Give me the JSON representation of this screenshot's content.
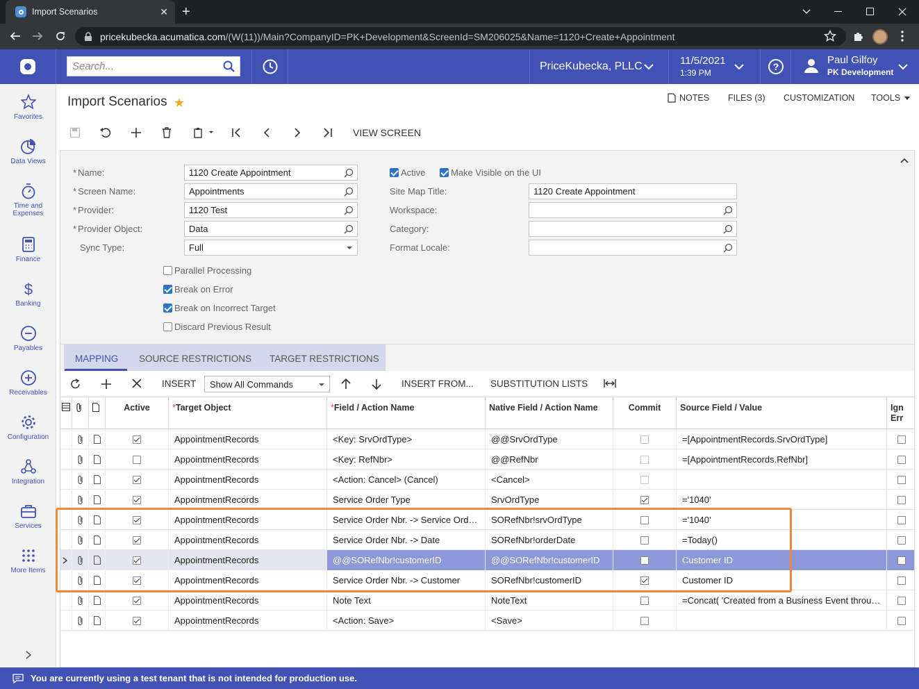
{
  "browser": {
    "tab_title": "Import Scenarios",
    "url_host": "pricekubecka.acumatica.com",
    "url_path": "/(W(11))/Main?CompanyID=PK+Development&ScreenId=SM206025&Name=1120+Create+Appointment"
  },
  "appbar": {
    "search_placeholder": "Search...",
    "company": "PriceKubecka, PLLC",
    "date": "11/5/2021",
    "time": "1:39 PM",
    "user_name": "Paul Gilfoy",
    "user_branch": "PK Development"
  },
  "sidebar": {
    "items": [
      {
        "label": "Favorites",
        "icon": "star-icon"
      },
      {
        "label": "Data Views",
        "icon": "pie-chart-icon"
      },
      {
        "label": "Time and Expenses",
        "icon": "stopwatch-icon"
      },
      {
        "label": "Finance",
        "icon": "calculator-icon"
      },
      {
        "label": "Banking",
        "icon": "dollar-icon"
      },
      {
        "label": "Payables",
        "icon": "minus-circle-icon"
      },
      {
        "label": "Receivables",
        "icon": "plus-circle-icon"
      },
      {
        "label": "Configuration",
        "icon": "gear-icon"
      },
      {
        "label": "Integration",
        "icon": "network-icon"
      },
      {
        "label": "Services",
        "icon": "briefcase-icon"
      },
      {
        "label": "More Items",
        "icon": "grid-dots-icon"
      }
    ]
  },
  "page": {
    "title": "Import Scenarios",
    "links": {
      "notes": "NOTES",
      "files": "FILES (3)",
      "customization": "CUSTOMIZATION",
      "tools": "TOOLS"
    },
    "view_screen": "VIEW SCREEN"
  },
  "form": {
    "name_label": "Name:",
    "name_value": "1120 Create Appointment",
    "screen_name_label": "Screen Name:",
    "screen_name_value": "Appointments",
    "provider_label": "Provider:",
    "provider_value": "1120 Test",
    "provider_object_label": "Provider Object:",
    "provider_object_value": "Data",
    "sync_type_label": "Sync Type:",
    "sync_type_value": "Full",
    "parallel_processing": "Parallel Processing",
    "break_on_error": "Break on Error",
    "break_on_incorrect_target": "Break on Incorrect Target",
    "discard_previous_result": "Discard Previous Result",
    "active": "Active",
    "make_visible": "Make Visible on the UI",
    "site_map_title_label": "Site Map Title:",
    "site_map_title_value": "1120 Create Appointment",
    "workspace_label": "Workspace:",
    "category_label": "Category:",
    "format_locale_label": "Format Locale:"
  },
  "tabs": {
    "mapping": "MAPPING",
    "source_restrictions": "SOURCE RESTRICTIONS",
    "target_restrictions": "TARGET RESTRICTIONS"
  },
  "grid_toolbar": {
    "insert": "INSERT",
    "show_commands": "Show All Commands",
    "insert_from": "INSERT FROM...",
    "substitution_lists": "SUBSTITUTION LISTS"
  },
  "grid": {
    "headers": {
      "active": "Active",
      "target_object": "Target Object",
      "field_action": "Field / Action Name",
      "native_field": "Native Field / Action Name",
      "commit": "Commit",
      "source_field": "Source Field / Value",
      "ignore1": "Ign",
      "ignore2": "Err"
    },
    "rows": [
      {
        "active": true,
        "target": "AppointmentRecords",
        "field": "<Key: SrvOrdType>",
        "native": "@@SrvOrdType",
        "commit": false,
        "commit_dim": true,
        "source": "=[AppointmentRecords.SrvOrdType]"
      },
      {
        "active": false,
        "target": "AppointmentRecords",
        "field": "<Key: RefNbr>",
        "native": "@@RefNbr",
        "commit": false,
        "commit_dim": true,
        "source": "=[AppointmentRecords.RefNbr]"
      },
      {
        "active": true,
        "target": "AppointmentRecords",
        "field": "<Action: Cancel> (Cancel)",
        "native": "<Cancel>",
        "commit": false,
        "commit_dim": true,
        "source": ""
      },
      {
        "active": true,
        "target": "AppointmentRecords",
        "field": "Service Order Type",
        "native": "SrvOrdType",
        "commit": true,
        "commit_dim": false,
        "source": "='1040'"
      },
      {
        "active": true,
        "target": "AppointmentRecords",
        "field": "Service Order Nbr. -> Service Ord…",
        "native": "SORefNbr!srvOrdType",
        "commit": false,
        "commit_dim": false,
        "source": "='1040'"
      },
      {
        "active": true,
        "target": "AppointmentRecords",
        "field": "Service Order Nbr. -> Date",
        "native": "SORefNbr!orderDate",
        "commit": false,
        "commit_dim": false,
        "source": "=Today()"
      },
      {
        "active": true,
        "target": "AppointmentRecords",
        "field": "@@SORefNbr!customerID",
        "native": "@@SORefNbr!customerID",
        "commit": false,
        "commit_dim": false,
        "source": "Customer ID"
      },
      {
        "active": true,
        "target": "AppointmentRecords",
        "field": "Service Order Nbr. -> Customer",
        "native": "SORefNbr!customerID",
        "commit": true,
        "commit_dim": false,
        "source": "Customer ID"
      },
      {
        "active": true,
        "target": "AppointmentRecords",
        "field": "Note Text",
        "native": "NoteText",
        "commit": false,
        "commit_dim": false,
        "source": "=Concat( 'Created from a Business Event throu…"
      },
      {
        "active": true,
        "target": "AppointmentRecords",
        "field": "<Action: Save>",
        "native": "<Save>",
        "commit": false,
        "commit_dim": false,
        "source": ""
      }
    ]
  },
  "footer": {
    "message": "You are currently using a test tenant that is not intended for production use."
  },
  "colors": {
    "brand": "#4052b5",
    "highlight_box": "#f0883a",
    "selected_row": "#8d98d8"
  }
}
